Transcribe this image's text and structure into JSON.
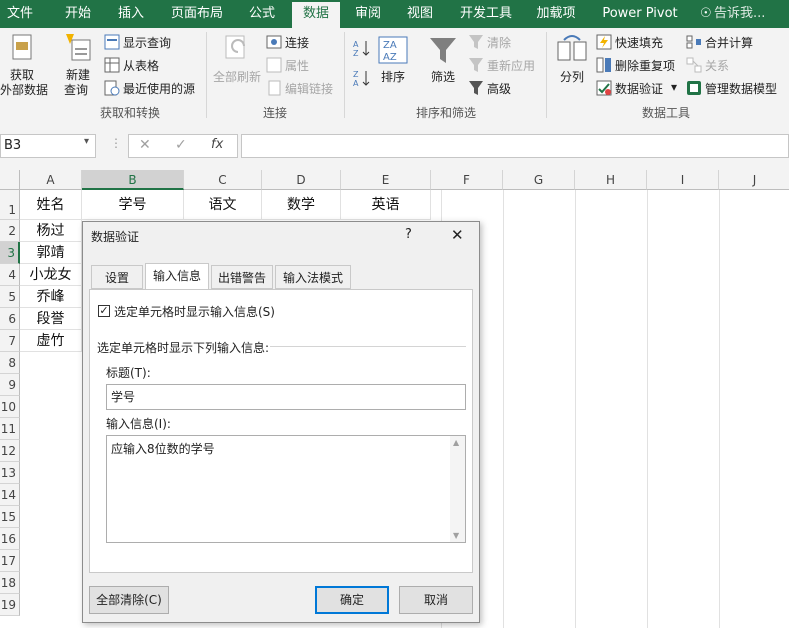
{
  "ribbon_tabs": [
    "文件",
    "开始",
    "插入",
    "页面布局",
    "公式",
    "数据",
    "审阅",
    "视图",
    "开发工具",
    "加载项",
    "Power Pivot"
  ],
  "active_tab": "数据",
  "tell_me": "告诉我...",
  "ribbon": {
    "get_external": "获取",
    "get_external2": "外部数据",
    "new_query": "新建",
    "new_query2": "查询",
    "show_query": "显示查询",
    "from_table": "从表格",
    "recent_sources": "最近使用的源",
    "group_get_transform": "获取和转换",
    "refresh_all": "全部刷新",
    "connections": "连接",
    "properties": "属性",
    "edit_links": "编辑链接",
    "group_connections": "连接",
    "sort": "排序",
    "filter": "筛选",
    "clear": "清除",
    "reapply": "重新应用",
    "advanced": "高级",
    "group_sort_filter": "排序和筛选",
    "text_to_columns": "分列",
    "flash_fill": "快速填充",
    "remove_duplicates": "删除重复项",
    "data_validation": "数据验证",
    "consolidate": "合并计算",
    "relationships": "关系",
    "manage_data_model": "管理数据模型",
    "group_data_tools": "数据工具"
  },
  "formula_bar": {
    "name_box": "B3",
    "fx": "fx",
    "value": ""
  },
  "grid": {
    "columns": [
      "A",
      "B",
      "C",
      "D",
      "E",
      "F",
      "G",
      "H",
      "I",
      "J"
    ],
    "selected_column": "B",
    "rows": [
      "1",
      "2",
      "3",
      "4",
      "5",
      "6",
      "7",
      "8",
      "9",
      "10",
      "11",
      "12",
      "13",
      "14",
      "15",
      "16",
      "17",
      "18",
      "19"
    ],
    "selected_row": "3",
    "header_row": [
      "姓名",
      "学号",
      "语文",
      "数学",
      "英语"
    ],
    "names": [
      "杨过",
      "郭靖",
      "小龙女",
      "乔峰",
      "段誉",
      "虚竹"
    ]
  },
  "dialog": {
    "title": "数据验证",
    "help": "?",
    "close": "✕",
    "tabs": [
      "设置",
      "输入信息",
      "出错警告",
      "输入法模式"
    ],
    "active_tab": "输入信息",
    "checkbox_label": "选定单元格时显示输入信息(S)",
    "checkbox_checked": true,
    "section_label": "选定单元格时显示下列输入信息:",
    "title_label": "标题(T):",
    "title_value": "学号",
    "message_label": "输入信息(I):",
    "message_value": "应输入8位数的学号",
    "clear_all": "全部清除(C)",
    "ok": "确定",
    "cancel": "取消"
  },
  "colors": {
    "excel_green": "#217346",
    "ribbon_bg": "#f3f3f3",
    "focus_blue": "#0078d7"
  }
}
